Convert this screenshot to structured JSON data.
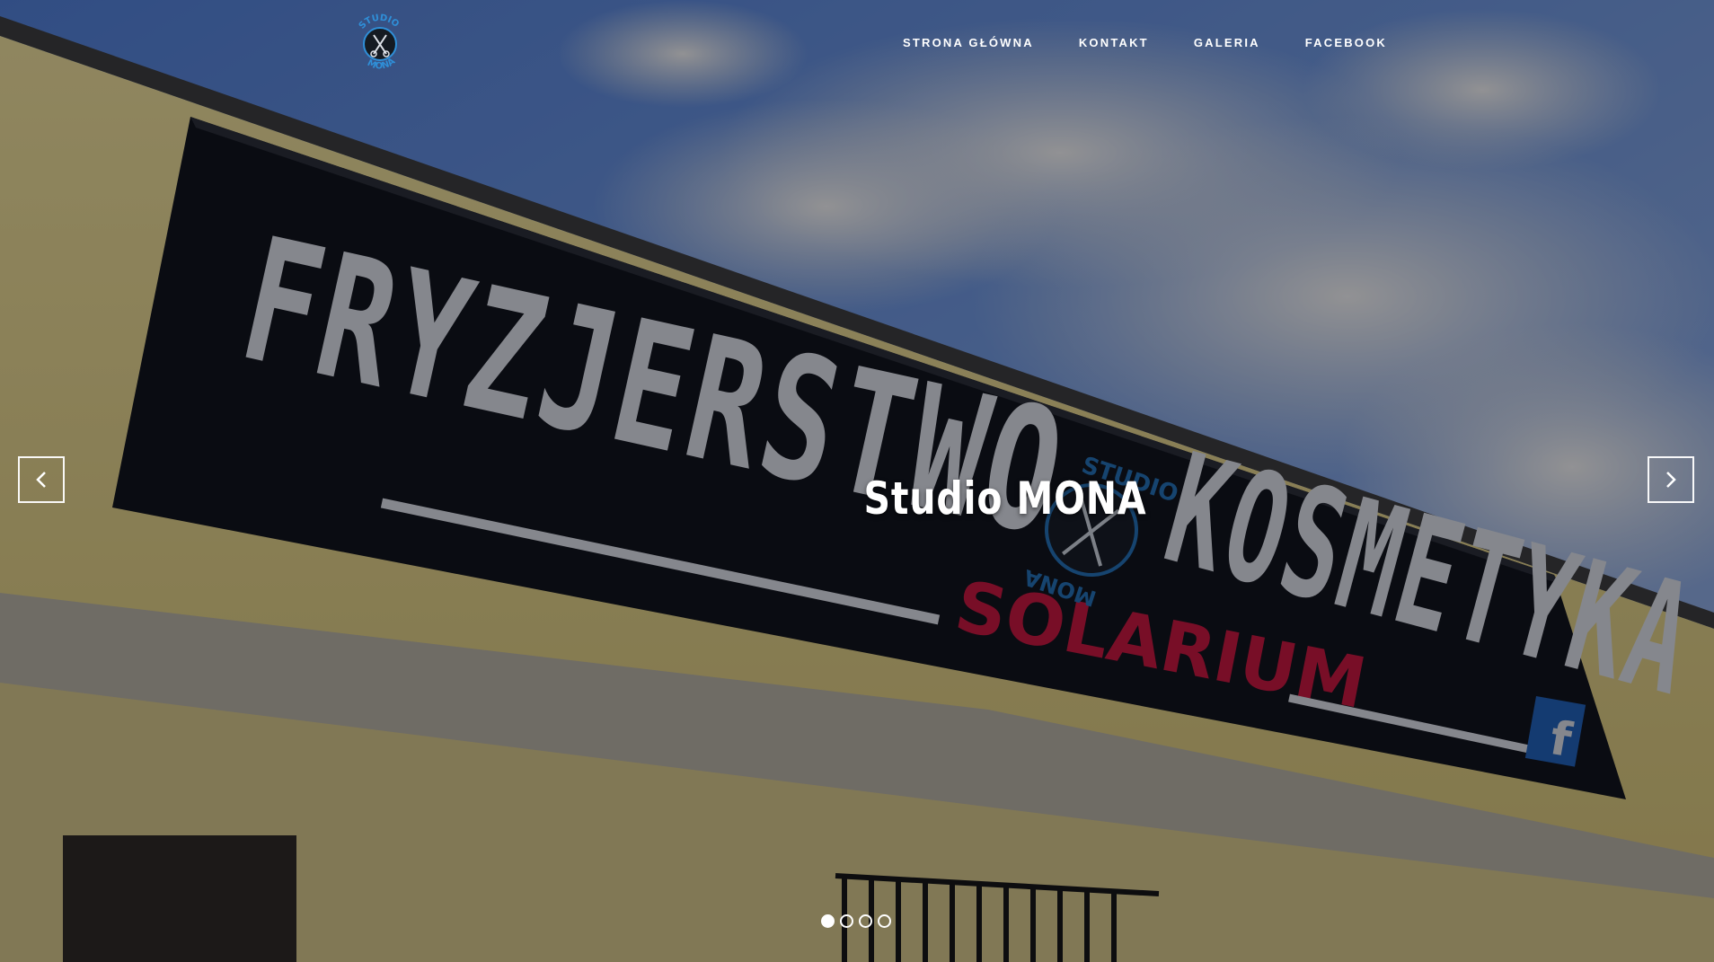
{
  "header": {
    "logo_icon": "studio-mona-scissors-logo",
    "logo_text_top": "STUDIO",
    "logo_text_bottom": "MONA",
    "nav": [
      {
        "label": "STRONA GŁÓWNA"
      },
      {
        "label": "KONTAKT"
      },
      {
        "label": "GALERIA"
      },
      {
        "label": "FACEBOOK"
      }
    ]
  },
  "slider": {
    "caption": "Studio MONA",
    "prev_icon": "chevron-left-icon",
    "next_icon": "chevron-right-icon",
    "dots_total": 4,
    "active_dot": 1
  },
  "photo": {
    "sign_line1": "FRYZJERSTWO",
    "sign_line2": "KOSMETYKA",
    "sign_line3": "SOLARIUM",
    "sign_logo_top": "STUDIO",
    "sign_logo_bottom": "MONA",
    "sign_facebook": "f"
  },
  "colors": {
    "accent_blue": "#2f8fd8",
    "sign_red": "#c8123a",
    "wall_yellow": "#e8d98a"
  }
}
